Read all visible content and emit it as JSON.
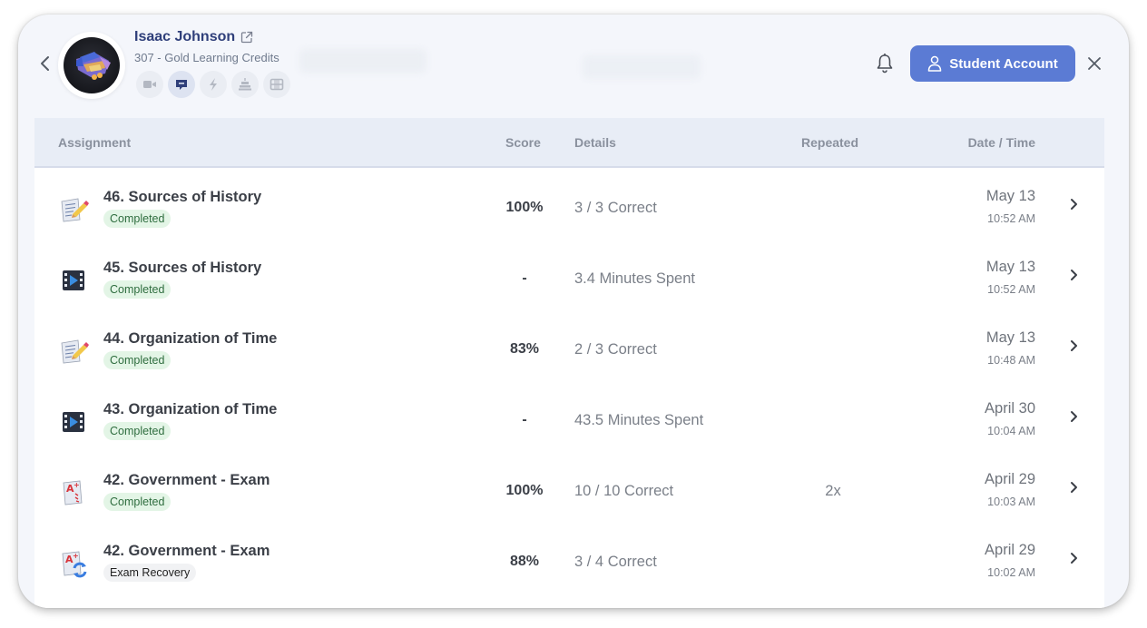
{
  "header": {
    "user_name": "Isaac Johnson",
    "credits": "307 - Gold Learning Credits",
    "quick_icons": [
      "video-camera-icon",
      "chat-bubble-icon",
      "lightning-icon",
      "cake-icon",
      "film-icon"
    ],
    "active_icon": "chat-bubble-icon",
    "student_account_label": "Student Account",
    "accent_color": "#5b7bd4"
  },
  "table": {
    "columns": {
      "assignment": "Assignment",
      "score": "Score",
      "details": "Details",
      "repeated": "Repeated",
      "date_time": "Date / Time"
    },
    "rows": [
      {
        "icon": "worksheet-icon",
        "title": "46. Sources of History",
        "status": "Completed",
        "score": "100%",
        "details": "3 / 3 Correct",
        "repeated": "",
        "date": "May 13",
        "time": "10:52 AM"
      },
      {
        "icon": "video-icon",
        "title": "45. Sources of History",
        "status": "Completed",
        "score": "-",
        "details": "3.4 Minutes Spent",
        "repeated": "",
        "date": "May 13",
        "time": "10:52 AM"
      },
      {
        "icon": "worksheet-icon",
        "title": "44. Organization of Time",
        "status": "Completed",
        "score": "83%",
        "details": "2 / 3 Correct",
        "repeated": "",
        "date": "May 13",
        "time": "10:48 AM"
      },
      {
        "icon": "video-icon",
        "title": "43. Organization of Time",
        "status": "Completed",
        "score": "-",
        "details": "43.5 Minutes Spent",
        "repeated": "",
        "date": "April 30",
        "time": "10:04 AM"
      },
      {
        "icon": "exam-icon",
        "title": "42. Government - Exam",
        "status": "Completed",
        "score": "100%",
        "details": "10 / 10 Correct",
        "repeated": "2x",
        "date": "April 29",
        "time": "10:03 AM"
      },
      {
        "icon": "exam-recovery-icon",
        "title": "42. Government - Exam",
        "status": "Exam Recovery",
        "score": "88%",
        "details": "3 / 4 Correct",
        "repeated": "",
        "date": "April 29",
        "time": "10:02 AM"
      }
    ]
  }
}
